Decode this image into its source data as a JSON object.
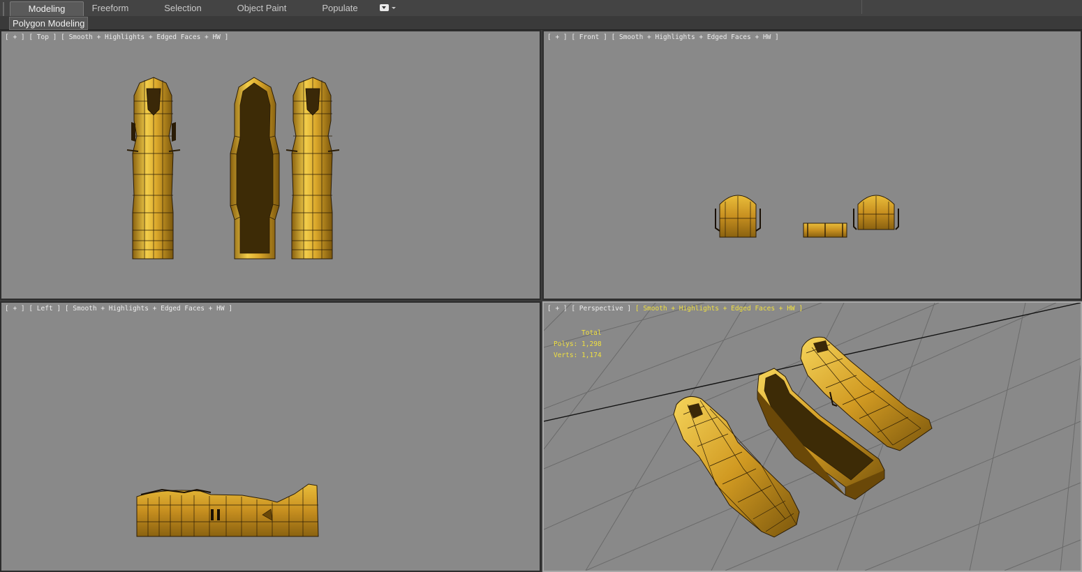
{
  "ribbon": {
    "tabs": [
      {
        "label": "Modeling",
        "active": true
      },
      {
        "label": "Freeform",
        "active": false
      },
      {
        "label": "Selection",
        "active": false
      },
      {
        "label": "Object Paint",
        "active": false
      },
      {
        "label": "Populate",
        "active": false
      }
    ],
    "panel_label": "Polygon Modeling"
  },
  "viewports": {
    "top": {
      "plus": "[ + ]",
      "name": "[ Top ]",
      "shading": "[ Smooth + Highlights + Edged Faces + HW ]"
    },
    "front": {
      "plus": "[ + ]",
      "name": "[ Front ]",
      "shading": "[ Smooth + Highlights + Edged Faces + HW ]"
    },
    "left": {
      "plus": "[ + ]",
      "name": "[ Left ]",
      "shading": "[ Smooth + Highlights + Edged Faces + HW ]"
    },
    "perspective": {
      "plus": "[ + ]",
      "name": "[ Perspective ]",
      "shading": "[ Smooth + Highlights + Edged Faces + HW ]",
      "active": true
    }
  },
  "stats": {
    "title": "Total",
    "polys_label": "Polys:",
    "polys_value": "1,298",
    "verts_label": "Verts:",
    "verts_value": "1,174"
  },
  "icons": {
    "tab_overflow": "dropdown-arrow-icon",
    "models": [
      "sarcophagus-lid-icon",
      "sarcophagus-base-icon",
      "sarcophagus-figure-icon"
    ]
  },
  "colors": {
    "viewport_bg": "#898989",
    "gold": "#d9a62a",
    "gold_dark": "#8a6210",
    "wire": "#2a1c06",
    "active_label": "#f0e040",
    "grid": "#6a6a6a"
  }
}
